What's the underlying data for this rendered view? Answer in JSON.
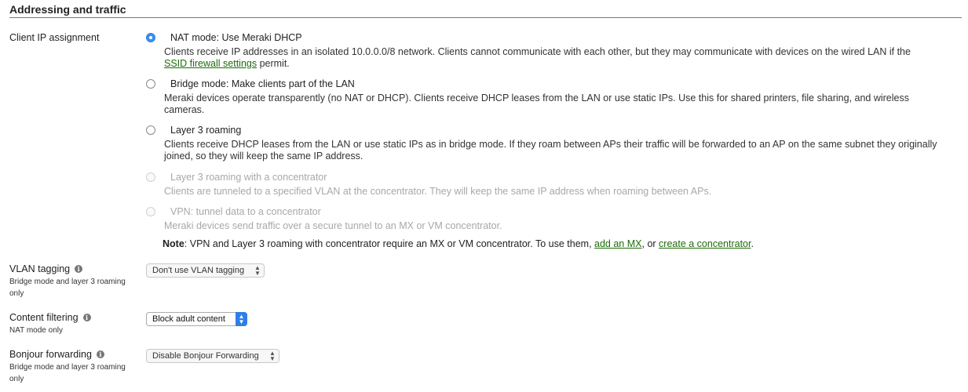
{
  "section": {
    "title": "Addressing and traffic"
  },
  "client_ip": {
    "label": "Client IP assignment",
    "options": [
      {
        "title": "NAT mode: Use Meraki DHCP",
        "desc": "Clients receive IP addresses in an isolated 10.0.0.0/8 network. Clients cannot communicate with each other, but they may communicate with devices on the wired LAN if the",
        "link": "SSID firewall settings",
        "desc_after": " permit.",
        "selected": true,
        "disabled": false
      },
      {
        "title": "Bridge mode: Make clients part of the LAN",
        "desc": "Meraki devices operate transparently (no NAT or DHCP). Clients receive DHCP leases from the LAN or use static IPs. Use this for shared printers, file sharing, and wireless cameras.",
        "selected": false,
        "disabled": false
      },
      {
        "title": "Layer 3 roaming",
        "desc": "Clients receive DHCP leases from the LAN or use static IPs as in bridge mode. If they roam between APs their traffic will be forwarded to an AP on the same subnet they originally joined, so they will keep the same IP address.",
        "selected": false,
        "disabled": false
      },
      {
        "title": "Layer 3 roaming with a concentrator",
        "desc": "Clients are tunneled to a specified VLAN at the concentrator. They will keep the same IP address when roaming between APs.",
        "selected": false,
        "disabled": true
      },
      {
        "title": "VPN: tunnel data to a concentrator",
        "desc": "Meraki devices send traffic over a secure tunnel to an MX or VM concentrator.",
        "selected": false,
        "disabled": true
      }
    ],
    "note": {
      "bold": "Note",
      "text": ": VPN and Layer 3 roaming with concentrator require an MX or VM concentrator. To use them, ",
      "link1": "add an MX",
      "mid": ", or ",
      "link2": "create a concentrator",
      "end": "."
    }
  },
  "vlan": {
    "label": "VLAN tagging",
    "sublabel": "Bridge mode and layer 3 roaming only",
    "value": "Don't use VLAN tagging",
    "info_icon": "info-icon"
  },
  "content": {
    "label": "Content filtering",
    "sublabel": "NAT mode only",
    "value": "Block adult content",
    "info_icon": "info-icon"
  },
  "bonjour": {
    "label": "Bonjour forwarding",
    "sublabel": "Bridge mode and layer 3 roaming only",
    "value": "Disable Bonjour Forwarding",
    "info_icon": "info-icon"
  },
  "colors": {
    "link": "#1e6b0a",
    "radio_selected": "#3b8ff0",
    "disabled_text": "#a8a8a8",
    "select_active": "#2f7ee8"
  }
}
